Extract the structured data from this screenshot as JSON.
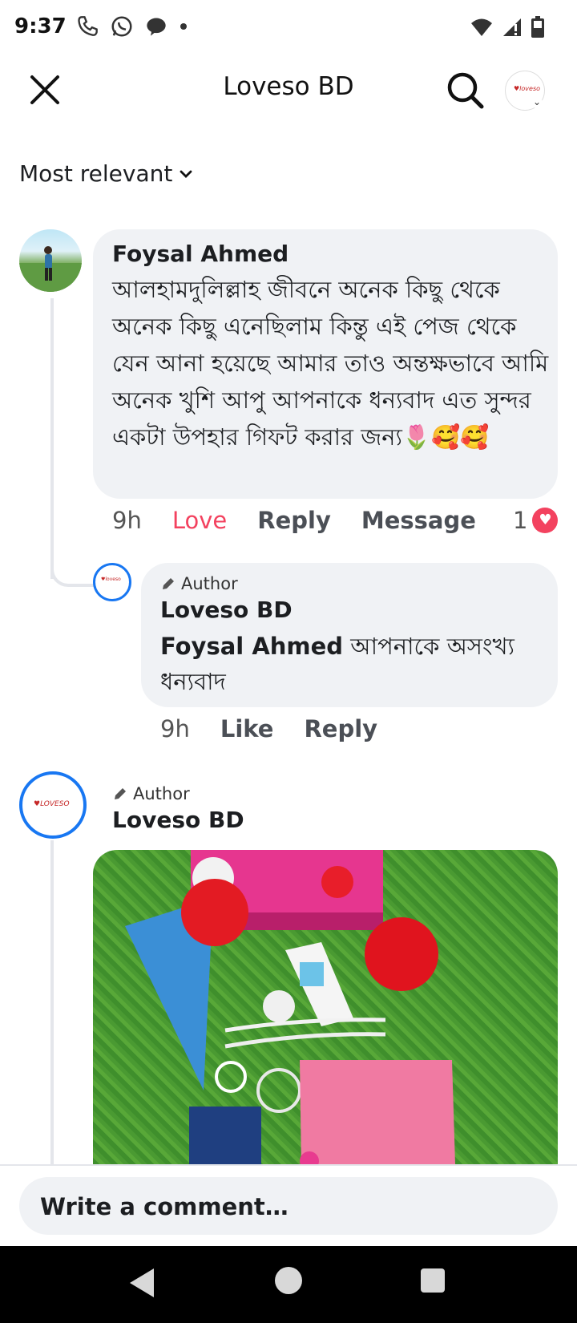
{
  "status_bar": {
    "time": "9:37"
  },
  "header": {
    "title": "Loveso BD"
  },
  "sort": {
    "label": "Most relevant"
  },
  "comment1": {
    "author": "Foysal Ahmed",
    "text": "আলহামদুলিল্লাহ জীবনে অনেক কিছু থেকে অনেক কিছু এনেছিলাম কিন্তু এই পেজ থেকে যেন আনা হয়েছে আমার তাও অন্তক্ষভাবে আমি অনেক খুশি আপু আপনাকে ধন্যবাদ এত সুন্দর একটা উপহার গিফট করার জন্য🌷🥰🥰",
    "time": "9h",
    "love_label": "Love",
    "reply_label": "Reply",
    "message_label": "Message",
    "reaction_count": "1"
  },
  "reply1": {
    "badge": "Author",
    "author": "Loveso BD",
    "mention": "Foysal Ahmed",
    "text": " আপনাকে অসংখ্য ধন্যবাদ",
    "time": "9h",
    "like_label": "Like",
    "reply_label": "Reply"
  },
  "comment2": {
    "badge": "Author",
    "author": "Loveso BD"
  },
  "composer": {
    "placeholder": "Write a comment…"
  },
  "colors": {
    "accent": "#1877f2",
    "bubble": "#f0f2f5",
    "love": "#f3425f"
  }
}
